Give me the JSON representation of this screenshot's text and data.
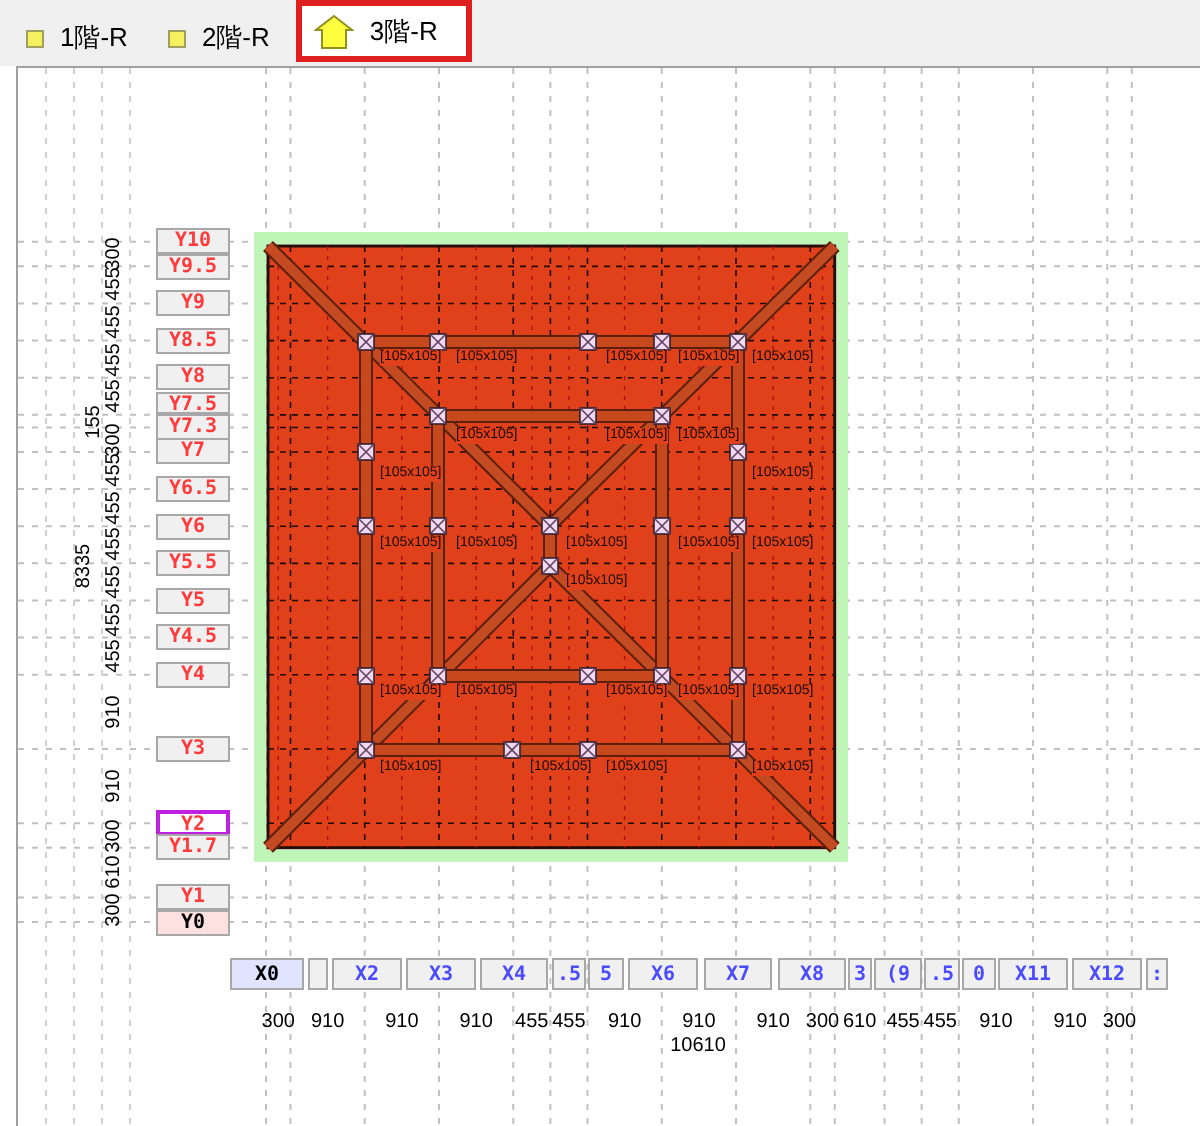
{
  "tabs": [
    {
      "label": "1階-R",
      "selected": false
    },
    {
      "label": "2階-R",
      "selected": false
    },
    {
      "label": "3階-R",
      "selected": true
    }
  ],
  "y_axis": [
    {
      "label": "Y10",
      "selected": false,
      "origin": false
    },
    {
      "label": "Y9.5",
      "selected": false,
      "origin": false
    },
    {
      "label": "Y9",
      "selected": false,
      "origin": false
    },
    {
      "label": "Y8.5",
      "selected": false,
      "origin": false
    },
    {
      "label": "Y8",
      "selected": false,
      "origin": false
    },
    {
      "label": "Y7.5",
      "selected": false,
      "origin": false
    },
    {
      "label": "Y7.3",
      "selected": false,
      "origin": false
    },
    {
      "label": "Y7",
      "selected": false,
      "origin": false
    },
    {
      "label": "Y6.5",
      "selected": false,
      "origin": false
    },
    {
      "label": "Y6",
      "selected": false,
      "origin": false
    },
    {
      "label": "Y5.5",
      "selected": false,
      "origin": false
    },
    {
      "label": "Y5",
      "selected": false,
      "origin": false
    },
    {
      "label": "Y4.5",
      "selected": false,
      "origin": false
    },
    {
      "label": "Y4",
      "selected": false,
      "origin": false
    },
    {
      "label": "Y3",
      "selected": false,
      "origin": false
    },
    {
      "label": "Y2",
      "selected": true,
      "origin": false
    },
    {
      "label": "Y1.7",
      "selected": false,
      "origin": false
    },
    {
      "label": "Y1",
      "selected": false,
      "origin": false
    },
    {
      "label": "Y0",
      "selected": false,
      "origin": true
    }
  ],
  "y_dimensions": [
    "300",
    "455",
    "455",
    "455",
    "455",
    "155",
    "300",
    "455",
    "455",
    "455",
    "455",
    "455",
    "455",
    "910",
    "910",
    "300",
    "610",
    "300"
  ],
  "y_total": "8335",
  "x_axis": [
    {
      "label": "X0",
      "selected": false,
      "origin": true
    },
    {
      "selected": false,
      "origin": false
    },
    {
      "label": "X2",
      "selected": false,
      "origin": false
    },
    {
      "label": "X3",
      "selected": false,
      "origin": false
    },
    {
      "label": "X4",
      "selected": false,
      "origin": false
    },
    {
      "label": ".5",
      "selected": false,
      "origin": false
    },
    {
      "label": "5",
      "selected": false,
      "origin": false
    },
    {
      "label": "X6",
      "selected": false,
      "origin": false
    },
    {
      "label": "X7",
      "selected": false,
      "origin": false
    },
    {
      "label": "X8",
      "selected": false,
      "origin": false
    },
    {
      "label": "3",
      "selected": false,
      "origin": false
    },
    {
      "label": "(9",
      "selected": false,
      "origin": false
    },
    {
      "label": ".5",
      "selected": false,
      "origin": false
    },
    {
      "label": "0",
      "selected": false,
      "origin": false
    },
    {
      "label": "X11",
      "selected": false,
      "origin": false
    },
    {
      "label": "X12",
      "selected": false,
      "origin": false
    },
    {
      "label": ":",
      "selected": false,
      "origin": false
    }
  ],
  "x_dimensions": [
    "300",
    "910",
    "910",
    "910",
    "455",
    "455",
    "910",
    "910",
    "910",
    "300",
    "610",
    "455",
    "455",
    "910",
    "910",
    "300"
  ],
  "x_total": "10610",
  "post_labels": [
    "[105x105]",
    "[105x105]",
    "[105x105]",
    "[105x105]",
    "[105x105]",
    "[105x105]",
    "[105x105]",
    "[105x105]",
    "[105x105]",
    "[105x105]",
    "[105x105]",
    "[105x105]",
    "[105x105]",
    "[105x105]",
    "[105x105]",
    "[105x105]",
    "[105x105]",
    "[105x105]",
    "[105x105]",
    "[105x105]",
    "[105x105]",
    "[105x105]",
    "[105x105]",
    "[105x105]",
    "[105x105]"
  ]
}
